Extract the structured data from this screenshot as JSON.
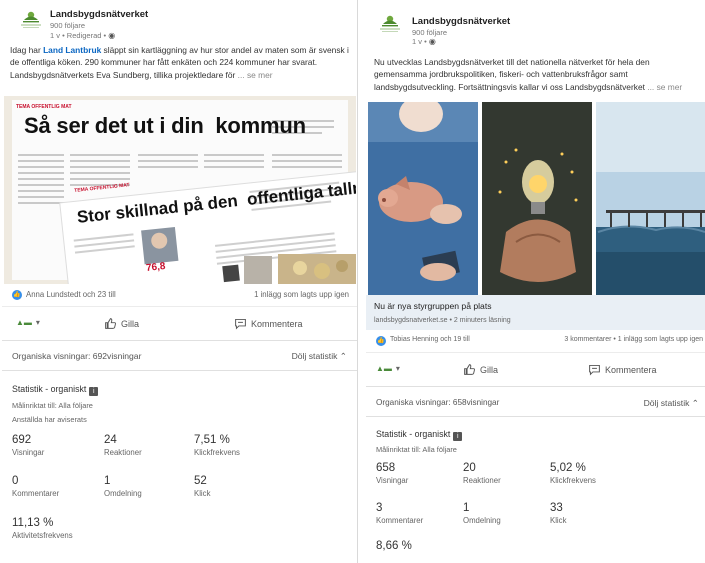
{
  "left_post": {
    "org_name": "Landsbygdsnätverket",
    "followers": "900 följare",
    "meta": "1 v • Redigerad •",
    "text_1": "Idag har ",
    "text_link": "Land Lantbruk",
    "text_2": " släppt sin kartläggning av hur stor andel av maten som är svensk i de offentliga köken. 290 kommuner har fått enkäten och 224 kommuner har svarat. Landsbygdsnätverkets Eva Sundberg, tillika projektledare för",
    "see_more": "... se mer",
    "image": {
      "tag_1": "TEMA OFFENTLIG MAT",
      "headline_1": "Så ser det ut i din  kommun",
      "tag_2": "TEMA OFFENTLIG MAT",
      "headline_2": "Stor skillnad på den  offentliga tallriken",
      "price": "76,8"
    },
    "reactions_names": "Anna Lundstedt och 23 till",
    "reactions_counts": "1 inlägg som lagts upp igen",
    "actions": {
      "like": "Gilla",
      "comment": "Kommentera"
    },
    "organic_views": "Organiska visningar: 692visningar",
    "hide_stats": "Dölj statistik",
    "stats": {
      "title": "Statistik - organiskt",
      "target": "Målinriktat till: Alla följare",
      "employees": "Anställda har aviserats",
      "metrics": [
        {
          "value": "692",
          "label": "Visningar"
        },
        {
          "value": "24",
          "label": "Reaktioner"
        },
        {
          "value": "7,51 %",
          "label": "Klickfrekvens"
        },
        {
          "value": "0",
          "label": "Kommentarer"
        },
        {
          "value": "1",
          "label": "Omdelning"
        },
        {
          "value": "52",
          "label": "Klick"
        },
        {
          "value": "11,13 %",
          "label": "Aktivitetsfrekvens"
        }
      ]
    }
  },
  "right_post": {
    "org_name": "Landsbygdsnätverket",
    "followers": "900 följare",
    "meta": "1 v •",
    "text": "Nu utvecklas Landsbygdsnätverket till det nationella nätverket för hela den gemensamma jordbrukspolitiken, fiskeri- och vattenbruksfrågor samt landsbygdsutveckling. Fortsättningsvis kallar vi oss Landsbygdsnätverket",
    "see_more": "... se mer",
    "link_title": "Nu är nya styrgruppen på plats",
    "link_source": "landsbygdsnatverket.se • 2 minuters läsning",
    "reactions_names": "Tobias Henning och 19 till",
    "reactions_counts": "3 kommentarer • 1 inlägg som lagts upp igen",
    "actions": {
      "like": "Gilla",
      "comment": "Kommentera"
    },
    "organic_views": "Organiska visningar: 658visningar",
    "hide_stats": "Dölj statistik",
    "stats": {
      "title": "Statistik - organiskt",
      "target": "Målinriktat till: Alla följare",
      "metrics": [
        {
          "value": "658",
          "label": "Visningar"
        },
        {
          "value": "20",
          "label": "Reaktioner"
        },
        {
          "value": "5,02 %",
          "label": "Klickfrekvens"
        },
        {
          "value": "3",
          "label": "Kommentarer"
        },
        {
          "value": "1",
          "label": "Omdelning"
        },
        {
          "value": "33",
          "label": "Klick"
        },
        {
          "value": "8,66 %",
          "label": ""
        }
      ]
    }
  },
  "colors": {
    "link": "#0a66c2",
    "like_badge": "#378fe9",
    "link_bar": "#e9eff5",
    "newspaper_red": "#c8102e"
  },
  "icons": [
    "organization-logo-icon",
    "globe-icon",
    "like-badge-icon",
    "thumbs-up-icon",
    "comment-icon",
    "chevron-up-icon",
    "caret-down-icon",
    "info-icon"
  ]
}
